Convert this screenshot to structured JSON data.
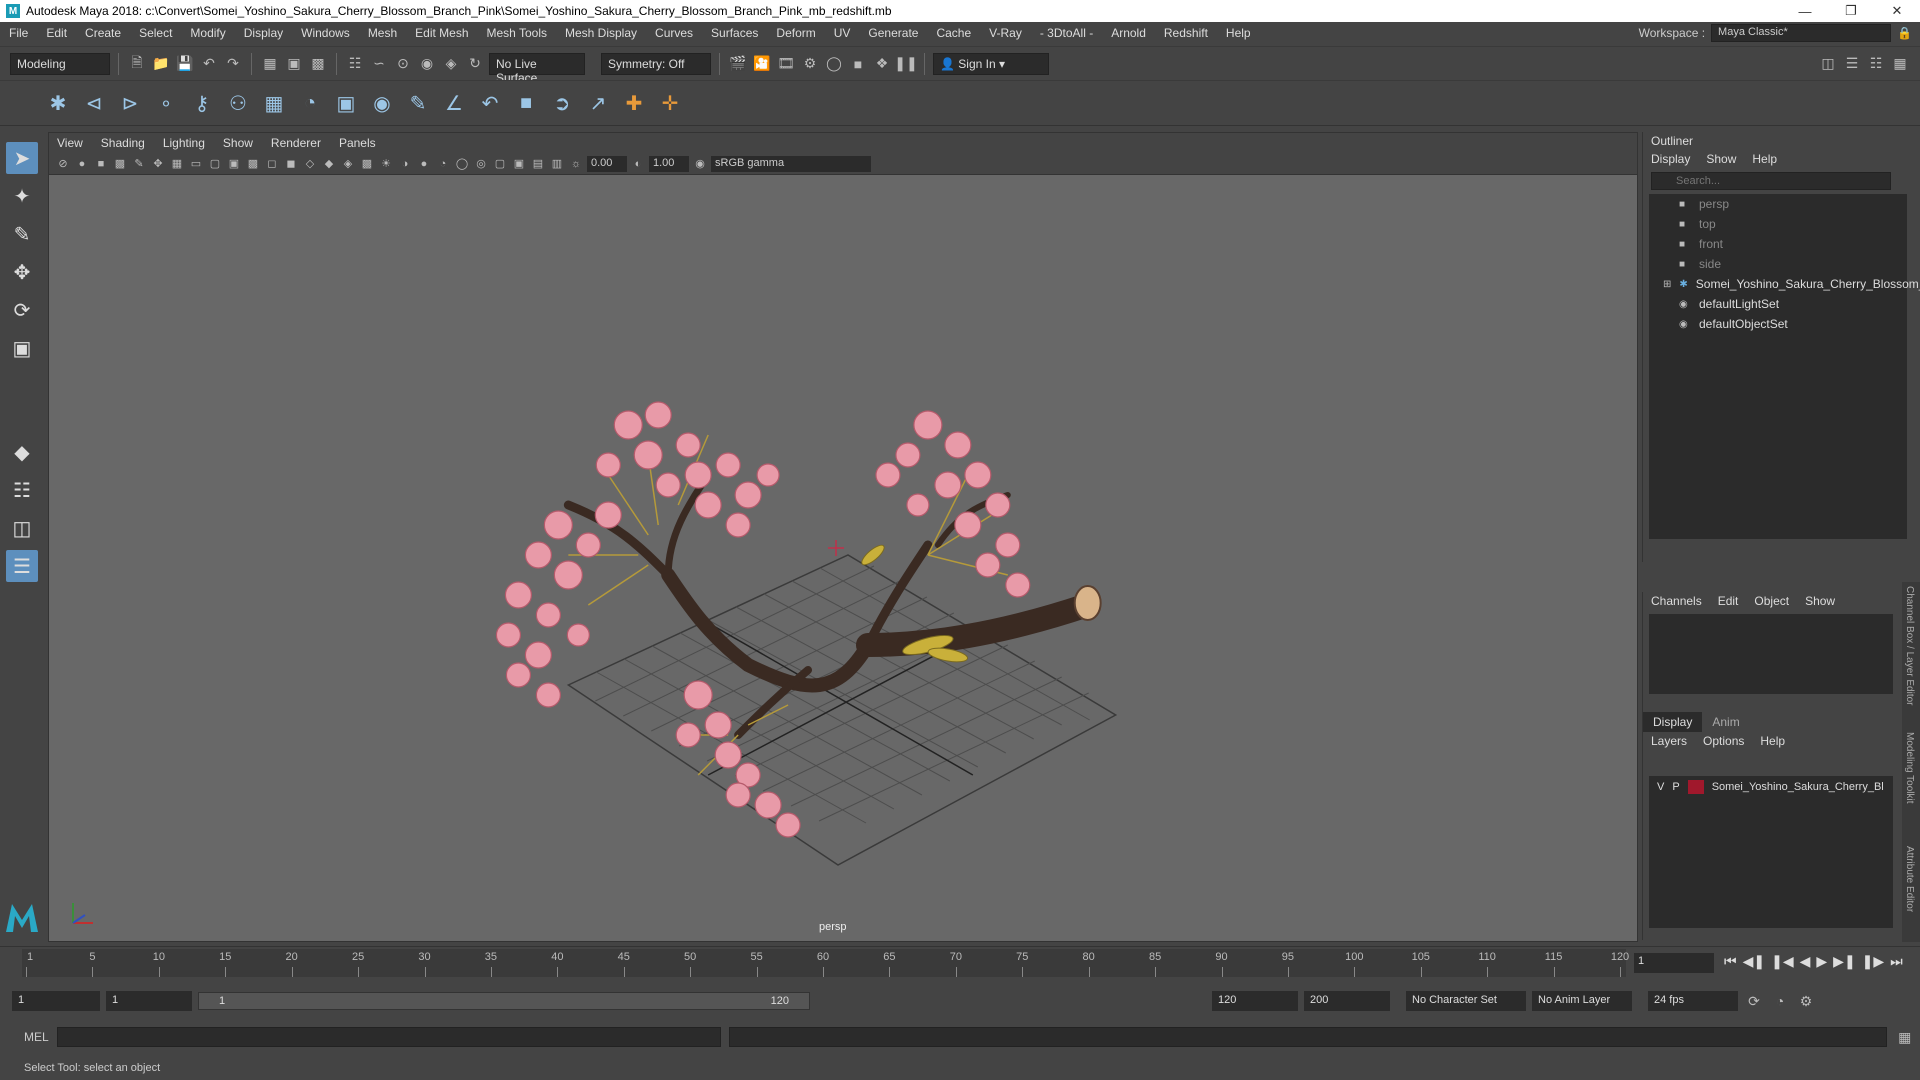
{
  "window": {
    "title": "Autodesk Maya 2018: c:\\Convert\\Somei_Yoshino_Sakura_Cherry_Blossom_Branch_Pink\\Somei_Yoshino_Sakura_Cherry_Blossom_Branch_Pink_mb_redshift.mb",
    "logo": "M"
  },
  "menu": {
    "items": [
      "File",
      "Edit",
      "Create",
      "Select",
      "Modify",
      "Display",
      "Windows",
      "Mesh",
      "Edit Mesh",
      "Mesh Tools",
      "Mesh Display",
      "Curves",
      "Surfaces",
      "Deform",
      "UV",
      "Generate",
      "Cache",
      "V-Ray",
      "- 3DtoAll -",
      "Arnold",
      "Redshift",
      "Help"
    ],
    "workspace_label": "Workspace :",
    "workspace_value": "Maya Classic*"
  },
  "status_line": {
    "mode": "Modeling",
    "live_surface": "No Live Surface",
    "symmetry": "Symmetry: Off",
    "sign_in": "Sign In"
  },
  "viewport": {
    "menus": [
      "View",
      "Shading",
      "Lighting",
      "Show",
      "Renderer",
      "Panels"
    ],
    "exposure": "0.00",
    "gamma": "1.00",
    "color_space": "sRGB gamma",
    "camera_label": "persp"
  },
  "outliner": {
    "title": "Outliner",
    "menus": [
      "Display",
      "Show",
      "Help"
    ],
    "search_placeholder": "Search...",
    "items": [
      {
        "label": "persp",
        "dim": true,
        "icon": "camera-icon"
      },
      {
        "label": "top",
        "dim": true,
        "icon": "camera-icon"
      },
      {
        "label": "front",
        "dim": true,
        "icon": "camera-icon"
      },
      {
        "label": "side",
        "dim": true,
        "icon": "camera-icon"
      },
      {
        "label": "Somei_Yoshino_Sakura_Cherry_Blossom_",
        "dim": false,
        "icon": "transform-icon"
      },
      {
        "label": "defaultLightSet",
        "dim": false,
        "icon": "set-icon"
      },
      {
        "label": "defaultObjectSet",
        "dim": false,
        "icon": "set-icon"
      }
    ]
  },
  "channel_box": {
    "menus": [
      "Channels",
      "Edit",
      "Object",
      "Show"
    ]
  },
  "layer_editor": {
    "tabs": [
      "Display",
      "Anim"
    ],
    "menus": [
      "Layers",
      "Options",
      "Help"
    ],
    "layer": {
      "v": "V",
      "p": "P",
      "name": "Somei_Yoshino_Sakura_Cherry_Bl",
      "color": "#a0182c"
    }
  },
  "side_tabs": [
    "Channel Box / Layer Editor",
    "Modeling Toolkit",
    "Attribute Editor"
  ],
  "time_slider": {
    "ticks": [
      "1",
      "5",
      "10",
      "15",
      "20",
      "25",
      "30",
      "35",
      "40",
      "45",
      "50",
      "55",
      "60",
      "65",
      "70",
      "75",
      "80",
      "85",
      "90",
      "95",
      "100",
      "105",
      "110",
      "115",
      "120"
    ],
    "current_frame": "1"
  },
  "range": {
    "start": "1",
    "playback_start": "1",
    "slider_start": "1",
    "slider_end": "120",
    "playback_end": "120",
    "end": "200",
    "character_set": "No Character Set",
    "anim_layer": "No Anim Layer",
    "fps": "24 fps"
  },
  "command_line": {
    "label": "MEL"
  },
  "help_line": {
    "text": "Select Tool: select an object"
  }
}
